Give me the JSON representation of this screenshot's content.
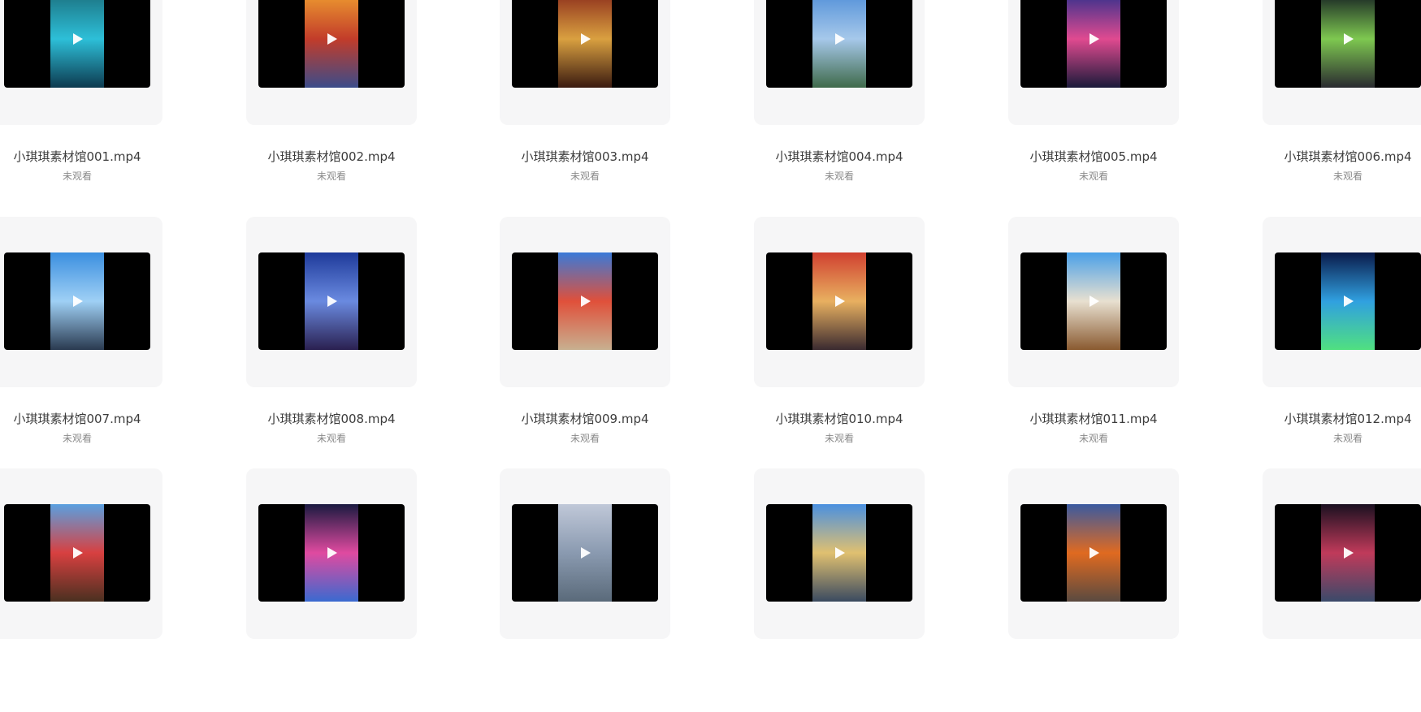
{
  "files": [
    {
      "name": "小琪琪素材馆001.mp4",
      "status": "未观看",
      "thumb_colors": [
        "#1b6f7d",
        "#2dbfd8",
        "#0d3a4f"
      ]
    },
    {
      "name": "小琪琪素材馆002.mp4",
      "status": "未观看",
      "thumb_colors": [
        "#f0a030",
        "#c23c2a",
        "#3b4c8a"
      ]
    },
    {
      "name": "小琪琪素材馆003.mp4",
      "status": "未观看",
      "thumb_colors": [
        "#8a2a1a",
        "#d9a040",
        "#3a1a10"
      ]
    },
    {
      "name": "小琪琪素材馆004.mp4",
      "status": "未观看",
      "thumb_colors": [
        "#4f8ed8",
        "#a6c8ea",
        "#3f6a4a"
      ]
    },
    {
      "name": "小琪琪素材馆005.mp4",
      "status": "未观看",
      "thumb_colors": [
        "#2a2f8c",
        "#e04a90",
        "#1a1a3a"
      ]
    },
    {
      "name": "小琪琪素材馆006.mp4",
      "status": "未观看",
      "thumb_colors": [
        "#101820",
        "#7ec850",
        "#2a2a30"
      ]
    },
    {
      "name": "小琪琪素材馆007.mp4",
      "status": "未观看",
      "thumb_colors": [
        "#3b8fe0",
        "#9fd0f5",
        "#2a3a50"
      ]
    },
    {
      "name": "小琪琪素材馆008.mp4",
      "status": "未观看",
      "thumb_colors": [
        "#1e3a9a",
        "#6a8ae0",
        "#2a2050"
      ]
    },
    {
      "name": "小琪琪素材馆009.mp4",
      "status": "未观看",
      "thumb_colors": [
        "#3a7ad8",
        "#e0503a",
        "#c8b090"
      ]
    },
    {
      "name": "小琪琪素材馆010.mp4",
      "status": "未观看",
      "thumb_colors": [
        "#d04030",
        "#e8b060",
        "#3a2a30"
      ]
    },
    {
      "name": "小琪琪素材馆011.mp4",
      "status": "未观看",
      "thumb_colors": [
        "#4aa0e8",
        "#e8e0d0",
        "#8a5a30"
      ]
    },
    {
      "name": "小琪琪素材馆012.mp4",
      "status": "未观看",
      "thumb_colors": [
        "#0a1a4a",
        "#30a0e0",
        "#50e080"
      ]
    },
    {
      "name": "",
      "status": "",
      "thumb_colors": [
        "#5aa0e0",
        "#d84040",
        "#4a3020"
      ]
    },
    {
      "name": "",
      "status": "",
      "thumb_colors": [
        "#1a1a40",
        "#e04aa0",
        "#3a6ad0"
      ]
    },
    {
      "name": "",
      "status": "",
      "thumb_colors": [
        "#c0c8d8",
        "#8a9ab0",
        "#5a6a7a"
      ]
    },
    {
      "name": "",
      "status": "",
      "thumb_colors": [
        "#4a90e0",
        "#e0c070",
        "#3a4a60"
      ]
    },
    {
      "name": "",
      "status": "",
      "thumb_colors": [
        "#3a5aa0",
        "#e06a20",
        "#5a4a40"
      ]
    },
    {
      "name": "",
      "status": "",
      "thumb_colors": [
        "#1a1020",
        "#c03a5a",
        "#3a4a6a"
      ]
    }
  ]
}
